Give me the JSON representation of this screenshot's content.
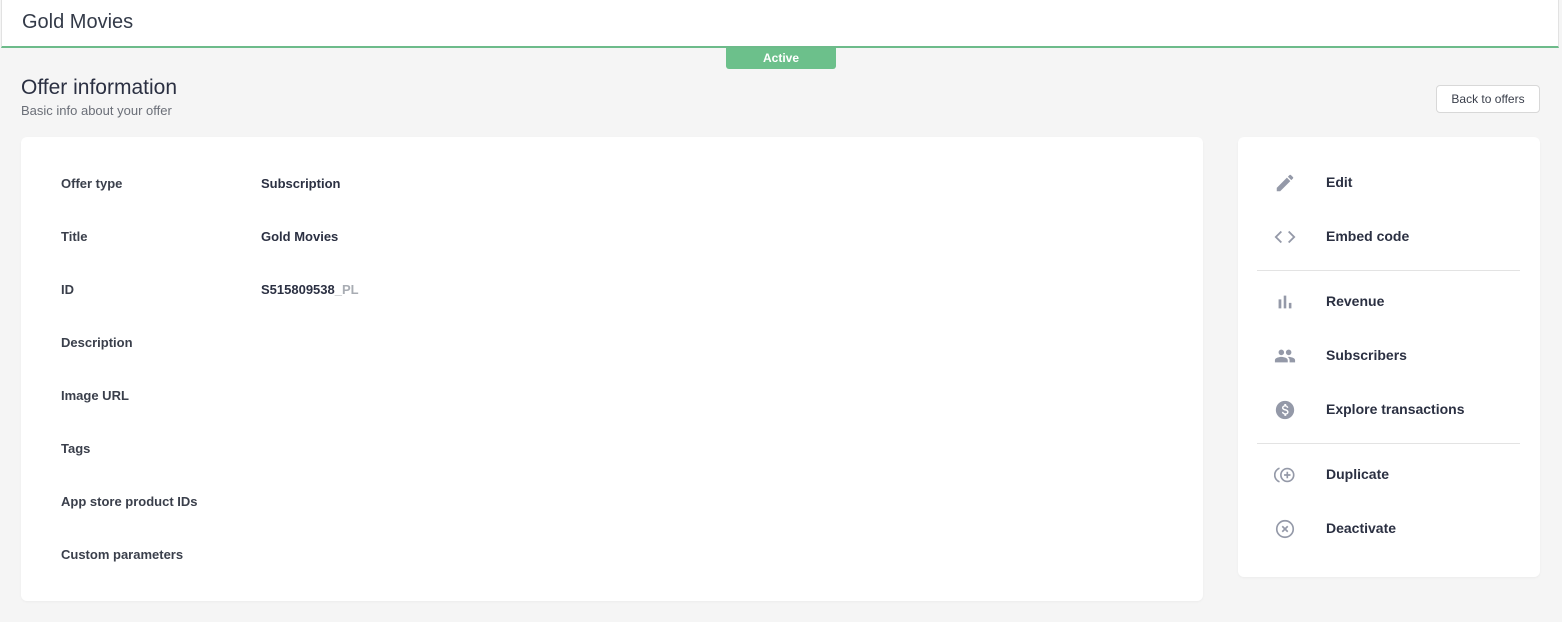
{
  "header": {
    "title": "Gold Movies"
  },
  "status": {
    "label": "Active"
  },
  "page": {
    "title": "Offer information",
    "subtitle": "Basic info about your offer",
    "back_label": "Back to offers"
  },
  "info": {
    "rows": [
      {
        "label": "Offer type",
        "value": "Subscription",
        "suffix": ""
      },
      {
        "label": "Title",
        "value": "Gold Movies",
        "suffix": ""
      },
      {
        "label": "ID",
        "value": "S515809538",
        "suffix": "_PL"
      },
      {
        "label": "Description",
        "value": "",
        "suffix": ""
      },
      {
        "label": "Image URL",
        "value": "",
        "suffix": ""
      },
      {
        "label": "Tags",
        "value": "",
        "suffix": ""
      },
      {
        "label": "App store product IDs",
        "value": "",
        "suffix": ""
      },
      {
        "label": "Custom parameters",
        "value": "",
        "suffix": ""
      }
    ]
  },
  "actions": {
    "items": [
      {
        "label": "Edit",
        "icon": "pencil-icon"
      },
      {
        "label": "Embed code",
        "icon": "code-icon"
      },
      {
        "label": "Revenue",
        "icon": "bar-chart-icon"
      },
      {
        "label": "Subscribers",
        "icon": "people-icon"
      },
      {
        "label": "Explore transactions",
        "icon": "dollar-icon"
      },
      {
        "label": "Duplicate",
        "icon": "duplicate-icon"
      },
      {
        "label": "Deactivate",
        "icon": "close-circle-icon"
      }
    ]
  },
  "colors": {
    "accent": "#6cc08b",
    "icon": "#9499a8",
    "text": "#2b3042",
    "background": "#f5f5f5"
  }
}
